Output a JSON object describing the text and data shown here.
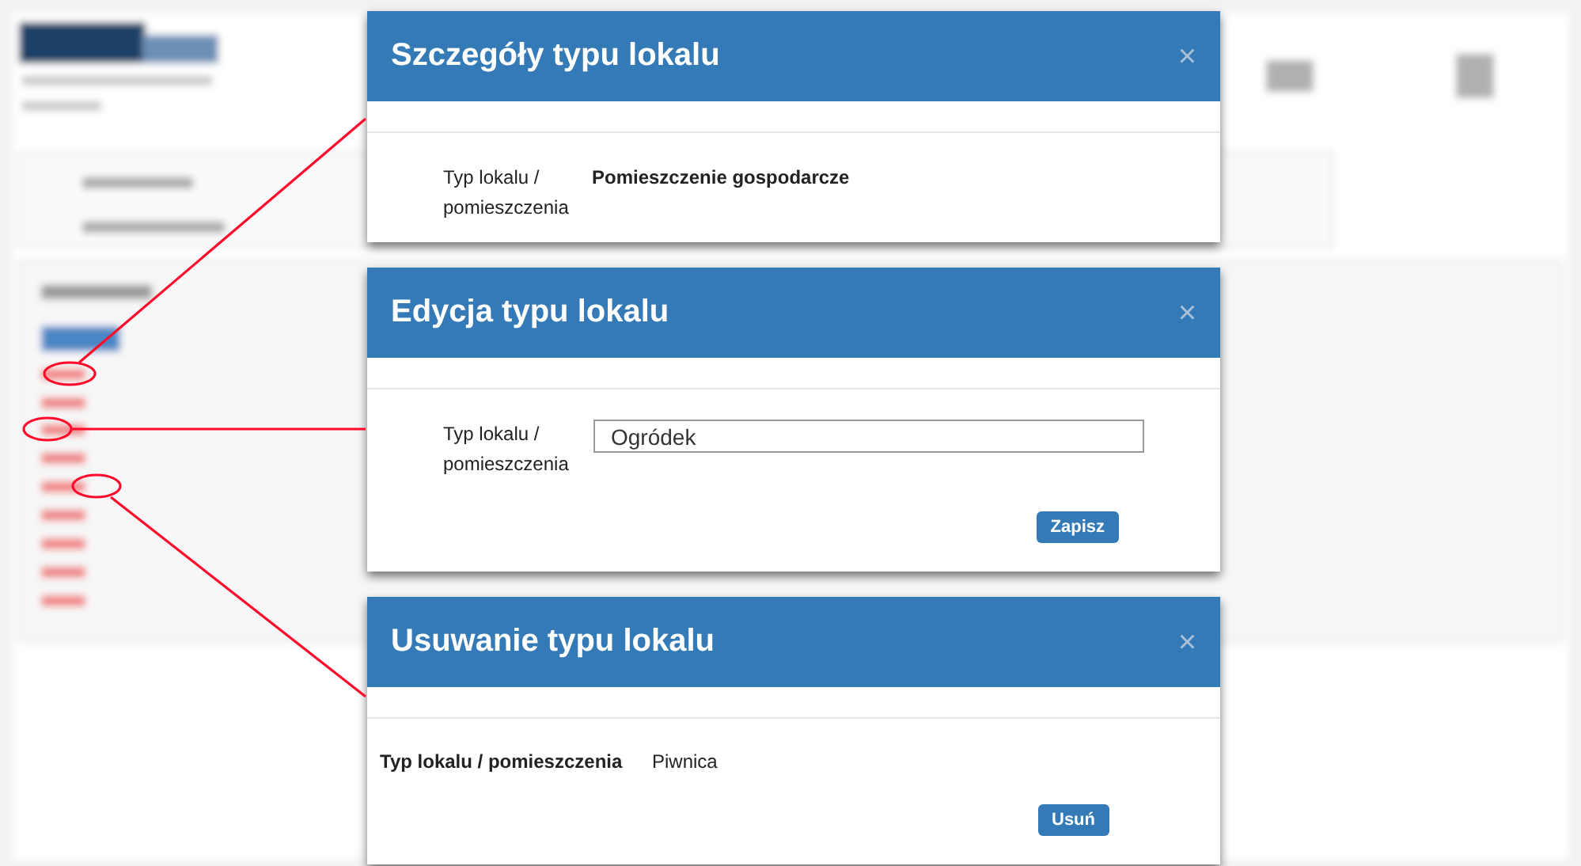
{
  "dialogs": [
    {
      "kind": "details",
      "title": "Szczegóły typu lokalu",
      "close": "×",
      "label": "Typ lokalu / pomieszczenia",
      "value": "Pomieszczenie gospodarcze"
    },
    {
      "kind": "edit",
      "title": "Edycja typu lokalu",
      "close": "×",
      "label": "Typ lokalu / pomieszczenia",
      "value": "Ogródek",
      "button": "Zapisz"
    },
    {
      "kind": "delete",
      "title": "Usuwanie typu lokalu",
      "close": "×",
      "label": "Typ lokalu / pomieszczenia",
      "value": "Piwnica",
      "button": "Usuń"
    }
  ]
}
